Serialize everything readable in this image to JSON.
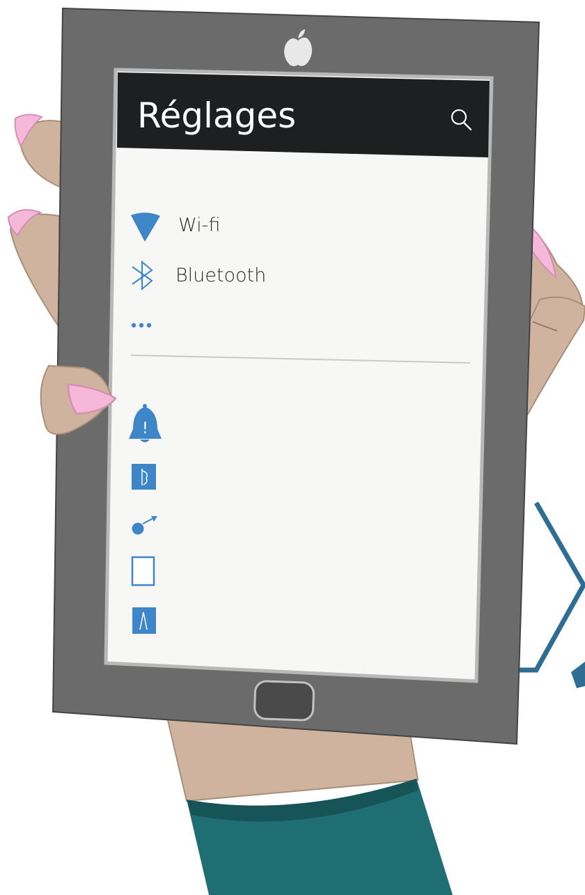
{
  "header": {
    "title": "Réglages",
    "search_icon": "search-icon"
  },
  "menu": {
    "connectivity": [
      {
        "icon": "wifi-icon",
        "label": "Wi-fi"
      },
      {
        "icon": "bluetooth-icon",
        "label": "Bluetooth"
      },
      {
        "icon": "more-dots-icon",
        "label": ""
      }
    ],
    "settings_icons": [
      {
        "icon": "notification-bell-icon",
        "glyph": "!"
      },
      {
        "icon": "sound-icon",
        "glyph": "𝅘𝅥"
      },
      {
        "icon": "display-icon",
        "glyph": ""
      },
      {
        "icon": "wallpaper-icon",
        "glyph": ""
      },
      {
        "icon": "font-icon",
        "glyph": "A"
      }
    ]
  },
  "device": {
    "logo": "apple-logo-icon",
    "home_button": "home-button"
  },
  "colors": {
    "accent": "#3f86c9",
    "header_bg": "#1d1f21",
    "screen_bg": "#f7f7f5",
    "frame": "#6b6b6b",
    "skin": "#cfb39f",
    "nail": "#f5b8d8",
    "sleeve": "#1f6e73",
    "hexagon": "#2f6d94"
  }
}
